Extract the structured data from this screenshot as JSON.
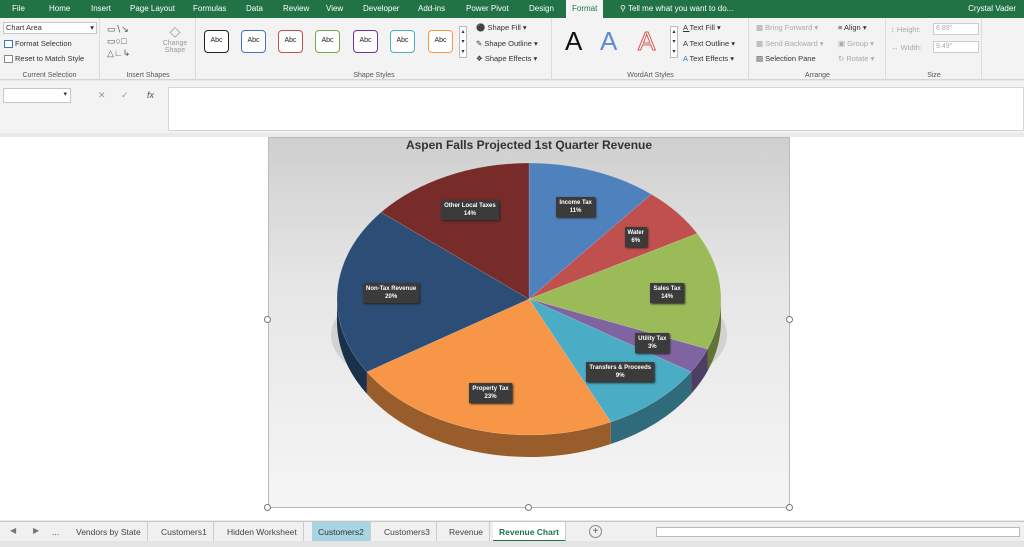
{
  "menu": {
    "tabs": [
      "File",
      "Home",
      "Insert",
      "Page Layout",
      "Formulas",
      "Data",
      "Review",
      "View",
      "Developer",
      "Add-ins",
      "Power Pivot",
      "Design",
      "Format"
    ],
    "tell_me": "Tell me what you want to do...",
    "user": "Crystal Vader"
  },
  "ribbon": {
    "current_selection": {
      "value": "Chart Area",
      "format_selection": "Format Selection",
      "reset": "Reset to Match Style",
      "label": "Current Selection"
    },
    "insert_shapes": {
      "change_shape": "Change Shape",
      "label": "Insert Shapes"
    },
    "shape_styles": {
      "swatch_text": "Abc",
      "swatch_colors": [
        "#222222",
        "#4472c4",
        "#c0504d",
        "#70ad47",
        "#7030a0",
        "#4bacc6",
        "#f79646"
      ],
      "fill": "Shape Fill",
      "outline": "Shape Outline",
      "effects": "Shape Effects",
      "label": "Shape Styles"
    },
    "wordart": {
      "glyph": "A",
      "text_fill": "Text Fill",
      "text_outline": "Text Outline",
      "text_effects": "Text Effects",
      "label": "WordArt Styles"
    },
    "arrange": {
      "bring_forward": "Bring Forward",
      "send_backward": "Send Backward",
      "selection_pane": "Selection Pane",
      "align": "Align",
      "group": "Group",
      "rotate": "Rotate",
      "label": "Arrange"
    },
    "size": {
      "height_label": "Height:",
      "height": "6.89\"",
      "width_label": "Width:",
      "width": "9.49\"",
      "label": "Size"
    }
  },
  "formula_bar": {
    "fx": "fx",
    "cancel": "✕",
    "enter": "✓"
  },
  "chart_data": {
    "type": "pie",
    "title": "Aspen Falls Projected 1st Quarter Revenue",
    "categories": [
      "Income Tax",
      "Water",
      "Sales Tax",
      "Utility Tax",
      "Transfers & Proceeds",
      "Property Tax",
      "Non-Tax Revenue",
      "Other Local Taxes"
    ],
    "values": [
      11,
      6,
      14,
      3,
      9,
      23,
      20,
      14
    ],
    "labels": [
      "11%",
      "6%",
      "14%",
      "3%",
      "9%",
      "23%",
      "20%",
      "14%"
    ],
    "colors": [
      "#4f81bd",
      "#c0504d",
      "#9bbb59",
      "#8064a2",
      "#4bacc6",
      "#f79646",
      "#2c4d75",
      "#772c2a"
    ],
    "legend": "none"
  },
  "sheets": {
    "tabs": [
      "Vendors by State",
      "Customers1",
      "Hidden Worksheet",
      "Customers2",
      "Customers3",
      "Revenue",
      "Revenue Chart"
    ],
    "selected": "Customers2",
    "active": "Revenue Chart",
    "ellipsis": "...",
    "add": "+"
  }
}
